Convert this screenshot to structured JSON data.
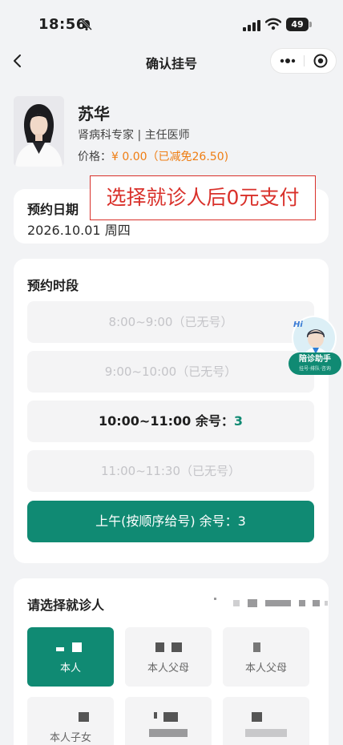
{
  "status_bar": {
    "time": "18:56",
    "battery": "49"
  },
  "nav": {
    "title": "确认挂号"
  },
  "doctor": {
    "name": "苏华",
    "title": "肾病科专家 | 主任医师",
    "price_label": "价格：",
    "price_value": "¥ 0.00（已减免26.50)"
  },
  "notice": "选择就诊人后0元支付",
  "date": {
    "label": "预约日期",
    "value": "2026.10.01 周四"
  },
  "slots": {
    "label": "预约时段",
    "items": [
      {
        "text": "8:00~9:00（已无号）",
        "state": "full"
      },
      {
        "text": "9:00~10:00（已无号）",
        "state": "full"
      },
      {
        "text": "10:00~11:00  余号：",
        "remain": "3",
        "state": "available"
      },
      {
        "text": "11:00~11:30（已无号）",
        "state": "full"
      },
      {
        "text": "上午(按顺序给号) 余号：3",
        "state": "selected"
      }
    ]
  },
  "assistant": {
    "hi": "Hi",
    "name": "陪诊助手",
    "sub": "挂号·排队·咨询"
  },
  "patients": {
    "label": "请选择就诊人",
    "tiles": [
      {
        "label": "本人",
        "selected": true
      },
      {
        "label": "本人父母",
        "selected": false
      },
      {
        "label": "本人父母",
        "selected": false
      },
      {
        "label": "本人子女",
        "selected": false
      },
      {
        "label": "",
        "selected": false
      },
      {
        "label": "",
        "selected": false
      }
    ]
  },
  "colors": {
    "accent": "#108a73",
    "price": "#ef7d12",
    "notice": "#d9302a"
  }
}
